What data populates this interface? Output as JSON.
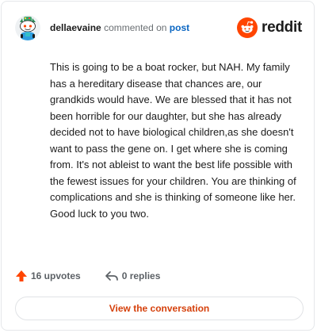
{
  "comment": {
    "author": "dellaevaine",
    "action_text": "commented on",
    "post_link": "post",
    "body": "This is going to be a boat rocker, but NAH. My family has a hereditary disease that chances are, our grandkids would have. We are blessed that it has not been horrible for our daughter, but she has already decided not to have biological children,as she doesn't want to pass the gene on. I get where she is coming from. It's not ableist to want the best life possible with the fewest issues for your children. You are thinking of complications and she is thinking of someone like her. Good luck to you two."
  },
  "brand": {
    "name": "reddit",
    "logo_icon": "reddit-snoo-icon",
    "accent_color": "#ff4500"
  },
  "actions": {
    "upvotes": "16 upvotes",
    "upvote_icon": "upvote-arrow-icon",
    "replies": "0 replies",
    "reply_icon": "reply-arrow-icon"
  },
  "cta": {
    "view_label": "View the conversation",
    "color": "#d5400b"
  }
}
